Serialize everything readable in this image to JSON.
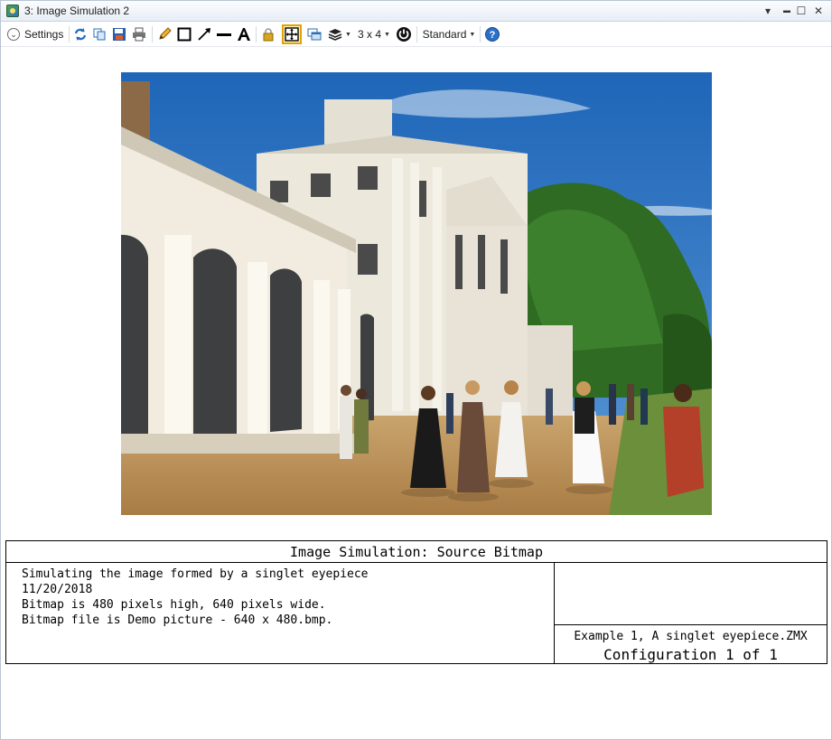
{
  "window": {
    "title": "3: Image Simulation 2",
    "controls": {
      "menu": "▾",
      "minimize": "▬",
      "maximize": "☐",
      "close": "✕"
    }
  },
  "toolbar": {
    "settings_label": "Settings",
    "layout_label": "3 x 4",
    "style_label": "Standard",
    "icons": [
      "refresh-icon",
      "copy-icon",
      "save-icon",
      "print-icon",
      "pencil-icon",
      "rectangle-icon",
      "arrow-line-icon",
      "line-icon",
      "text-icon",
      "lock-icon",
      "zoom-fit-icon",
      "window-clone-icon",
      "layers-icon",
      "layout-icon",
      "power-icon",
      "style-icon",
      "help-icon"
    ]
  },
  "colors": {
    "accent": "#1f6fc4",
    "highlight_border": "#e0a400",
    "sky": "#2f78c8",
    "building": "#ece8dc",
    "ground": "#b98f55"
  },
  "info": {
    "title": "Image Simulation: Source Bitmap",
    "lines": [
      "Simulating the image formed by a singlet eyepiece",
      "11/20/2018",
      "Bitmap is 480 pixels high, 640 pixels wide.",
      "Bitmap file is Demo picture -  640 x 480.bmp."
    ],
    "file_name": "Example 1, A singlet eyepiece.ZMX",
    "configuration": "Configuration 1 of 1"
  }
}
